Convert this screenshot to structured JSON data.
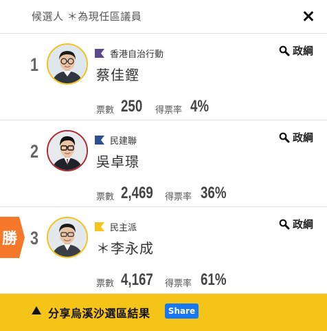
{
  "header": {
    "title": "候選人 ＊為現任區議員"
  },
  "candidates": [
    {
      "rank": "1",
      "party": "香港自治行動",
      "name": "蔡佳鏗",
      "manifesto_label": "政綱",
      "votes_label": "票數",
      "votes": "250",
      "rate_label": "得票率",
      "rate": "4%",
      "ring_color": "#f2c21a",
      "flag_color": "#5b4a8b",
      "won": false
    },
    {
      "rank": "2",
      "party": "民建聯",
      "name": "吳卓璟",
      "manifesto_label": "政綱",
      "votes_label": "票數",
      "votes": "2,469",
      "rate_label": "得票率",
      "rate": "36%",
      "ring_color": "#b0272e",
      "flag_color": "#2b4f8f",
      "won": false
    },
    {
      "rank": "3",
      "party": "民主派",
      "name": "＊李永成",
      "manifesto_label": "政綱",
      "votes_label": "票數",
      "votes": "4,167",
      "rate_label": "得票率",
      "rate": "61%",
      "ring_color": "#f2c21a",
      "flag_color": "#f5c419",
      "won": true
    }
  ],
  "win_badge": {
    "label": "勝",
    "color": "#f4772a"
  },
  "share": {
    "text": "分享烏溪沙選區結果",
    "button_label": "Share"
  }
}
